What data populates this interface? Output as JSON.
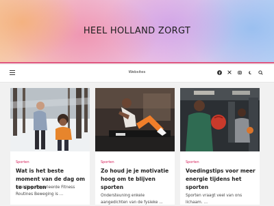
{
  "header": {
    "title": "HEEL HOLLAND ZORGT",
    "accent_color": "#e0557f"
  },
  "nav": {
    "menu_icon": "hamburger-menu-icon",
    "center_label": "Websites",
    "icons": [
      "facebook-icon",
      "x-twitter-icon",
      "instagram-icon",
      "dark-mode-moon-icon",
      "search-icon"
    ]
  },
  "cards": [
    {
      "category": "Sporten",
      "title": "Wat is het beste moment van de dag om te sporten",
      "excerpt": "Inleiding: Gevarieerde Fitness Routines Beweging is ..."
    },
    {
      "category": "Sporten",
      "title": "Zo houd je je motivatie hoog om te blijven sporten",
      "excerpt": "Ondersteuning enkele aangedichten van de fysieke ..."
    },
    {
      "category": "Sporten",
      "title": "Voedingstips voor meer energie tijdens het sporten",
      "excerpt": "Sporten vraagt veel van ons lichaam. ..."
    }
  ],
  "colors": {
    "category": "#d6245d",
    "page_bg": "#f1f1f1"
  }
}
